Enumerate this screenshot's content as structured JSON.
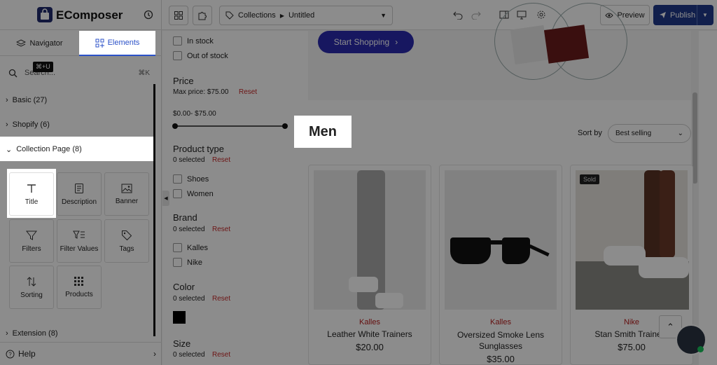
{
  "app": {
    "logo_text": "EComposer"
  },
  "sidebar": {
    "tabs": [
      {
        "label": "Navigator"
      },
      {
        "label": "Elements"
      }
    ],
    "search": {
      "placeholder": "Search...",
      "shortcut": "⌘K",
      "tooltip": "⌘+U"
    },
    "sections": [
      {
        "label": "Basic (27)"
      },
      {
        "label": "Shopify (6)"
      },
      {
        "label": "Collection Page (8)"
      },
      {
        "label": "Extension (8)"
      }
    ],
    "elements": [
      {
        "label": "Title",
        "icon": "text-t-icon"
      },
      {
        "label": "Description",
        "icon": "document-icon"
      },
      {
        "label": "Banner",
        "icon": "image-icon"
      },
      {
        "label": "Filters",
        "icon": "funnel-icon"
      },
      {
        "label": "Filter Values",
        "icon": "filter-values-icon"
      },
      {
        "label": "Tags",
        "icon": "tag-icon"
      },
      {
        "label": "Sorting",
        "icon": "sort-icon"
      },
      {
        "label": "Products",
        "icon": "grid-icon"
      }
    ],
    "help": "Help"
  },
  "toolbar": {
    "breadcrumb": {
      "section": "Collections",
      "page": "Untitled"
    },
    "preview": "Preview",
    "publish": "Publish"
  },
  "canvas": {
    "availability": [
      {
        "label": "In stock"
      },
      {
        "label": "Out of stock"
      }
    ],
    "price": {
      "title": "Price",
      "max_label": "Max price: $75.00",
      "reset": "Reset",
      "range": "$0.00- $75.00"
    },
    "product_type": {
      "title": "Product type",
      "selected": "0 selected",
      "reset": "Reset",
      "options": [
        "Shoes",
        "Women"
      ]
    },
    "brand": {
      "title": "Brand",
      "selected": "0 selected",
      "reset": "Reset",
      "options": [
        "Kalles",
        "Nike"
      ]
    },
    "color": {
      "title": "Color",
      "selected": "0 selected",
      "reset": "Reset",
      "swatch": "#000000"
    },
    "size": {
      "title": "Size",
      "selected": "0 selected",
      "reset": "Reset"
    },
    "hero_button": "Start Shopping",
    "collection_title": "Men",
    "sort": {
      "label": "Sort by",
      "value": "Best selling"
    },
    "products": [
      {
        "vendor": "Kalles",
        "name": "Leather White Trainers",
        "price": "$20.00",
        "badge": ""
      },
      {
        "vendor": "Kalles",
        "name": "Oversized Smoke Lens Sunglasses",
        "price": "$35.00",
        "badge": ""
      },
      {
        "vendor": "Nike",
        "name": "Stan Smith Trainers",
        "price": "$75.00",
        "badge": "Sold"
      }
    ],
    "brand_color": "#2a2ab0"
  }
}
